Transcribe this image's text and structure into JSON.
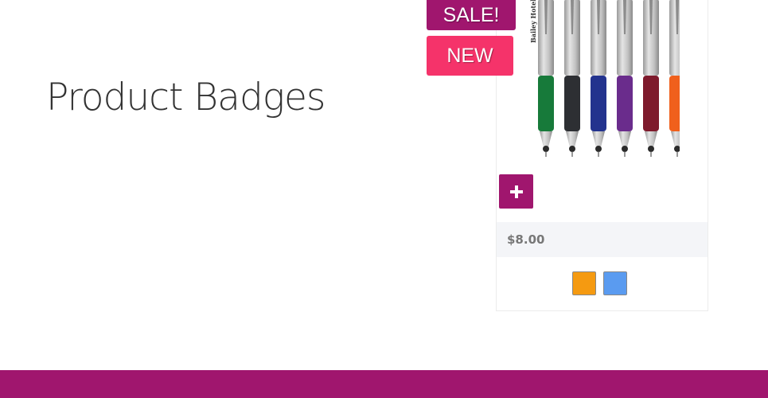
{
  "section": {
    "title": "Product Badges"
  },
  "badges": {
    "sale": "SALE!",
    "new": "NEW"
  },
  "product": {
    "imprint_text": "Bailey Hotel",
    "add_icon": "plus-icon",
    "price": "$8.00",
    "pen_colors": [
      "#177a3a",
      "#2d2f33",
      "#23338e",
      "#6a2c8c",
      "#7e1a2c",
      "#f0601c"
    ],
    "swatches": [
      {
        "color": "#f59a11"
      },
      {
        "color": "#5a9bf0"
      }
    ]
  },
  "colors": {
    "brand": "#a0166e",
    "new_badge": "#f5336a",
    "footer": "#a0166e"
  }
}
